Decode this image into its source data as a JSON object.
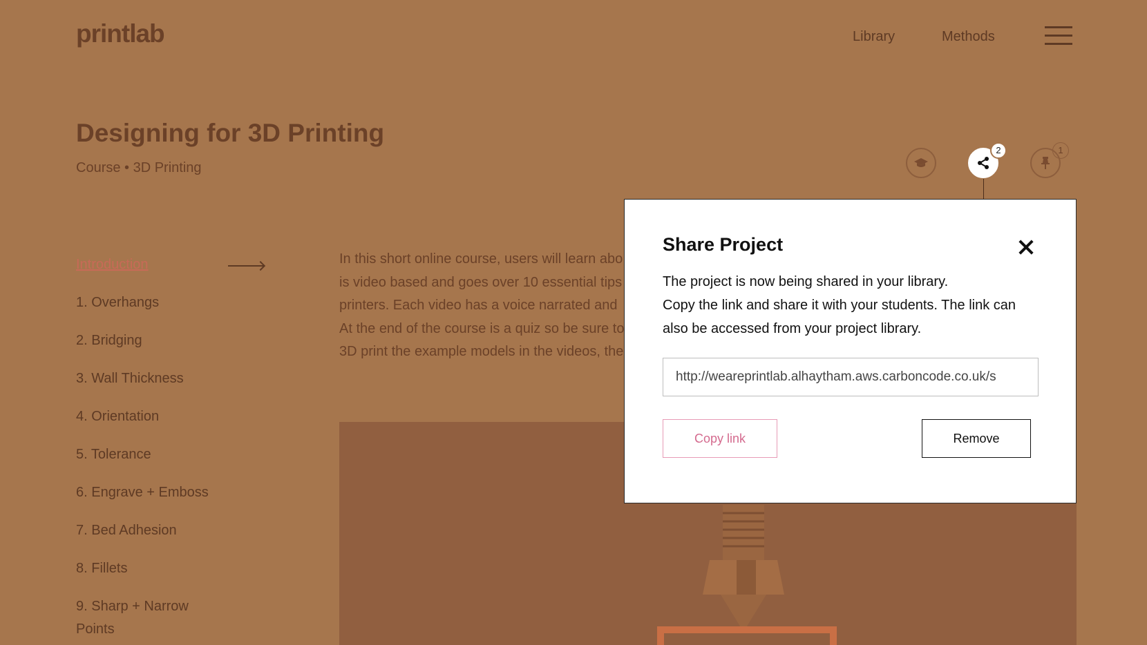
{
  "brand": {
    "logo": "printlab"
  },
  "nav": {
    "library": "Library",
    "methods": "Methods"
  },
  "header": {
    "title": "Designing for 3D Printing",
    "subtitle": "Course • 3D Printing",
    "share_count": "2",
    "pin_count": "1"
  },
  "sidebar": {
    "items": [
      {
        "label": "Introduction"
      },
      {
        "label": "1. Overhangs"
      },
      {
        "label": "2. Bridging"
      },
      {
        "label": "3. Wall Thickness"
      },
      {
        "label": "4. Orientation"
      },
      {
        "label": "5. Tolerance"
      },
      {
        "label": "6. Engrave + Emboss"
      },
      {
        "label": "7. Bed Adhesion"
      },
      {
        "label": "8. Fillets"
      },
      {
        "label": "9. Sharp + Narrow"
      },
      {
        "label": "Points"
      }
    ]
  },
  "intro": {
    "lines": [
      "In this short online course, users will learn abo",
      "is video based and goes over 10 essential tips",
      "printers. Each video has a voice narrated and",
      "At the end of the course is a quiz so be sure to",
      "3D print the example models in the videos, the"
    ]
  },
  "modal": {
    "title": "Share Project",
    "line1": "The project is now being shared in your library.",
    "line2": "Copy the link and share it with your students. The link can",
    "line3": "also be accessed from your project library.",
    "link_value": "http://weareprintlab.alhaytham.aws.carboncode.co.uk/s",
    "copy_label": "Copy link",
    "remove_label": "Remove"
  },
  "icons": {
    "menu": "hamburger-menu-icon",
    "course": "graduation-cap-icon",
    "share": "share-icon",
    "pin": "pin-icon",
    "close": "close-icon",
    "arrow": "arrow-right-icon"
  },
  "colors": {
    "overlay_background": "#a6764d",
    "active_link": "#c86a57",
    "copy_button": "#d46a8e",
    "modal_background": "#ffffff"
  }
}
